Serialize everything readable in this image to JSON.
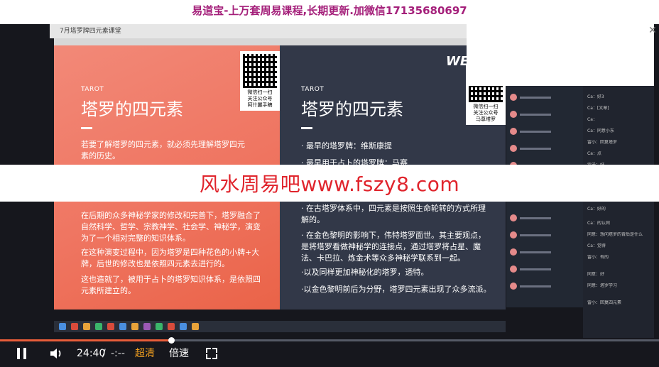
{
  "banner": {
    "text": "易道宝-上万套周易课程,长期更新.加微信17135680697"
  },
  "overlay": {
    "text": "风水周易吧www.fszy8.com"
  },
  "window": {
    "title": "7月塔罗牌四元素课堂"
  },
  "slide_left": {
    "tarot_label": "TAROT",
    "title": "塔罗的四元素",
    "intro": "若要了解塔罗的四元素，就必须先理解塔罗四元素的历史。",
    "paragraphs": [
      "在后期的众多神秘学家的修改和完善下，塔罗融合了自然科学、哲学、宗教神学、社会学、神秘学，演变为了一个相对完整的知识体系。",
      "在这种演变过程中，因为塔罗是四种花色的小牌+大牌，后世的修改也是依照四元素去进行的。",
      "这也造就了，被用于占卜的塔罗知识体系，是依照四元素所建立的。"
    ],
    "qr_caption": "微信扫一扫\n关注公众号\n阿什麗手稿"
  },
  "slide_right": {
    "tarot_label": "TAROT",
    "title": "塔罗的四元素",
    "bullets": [
      "· 最早的塔罗牌：维斯康提",
      "· 最早用于占卜的塔罗牌：马赛",
      "· 在古塔罗体系中，四元素是按照生命轮转的方式所理解的。",
      "· 在金色黎明的影响下，伟特塔罗面世。其主要观点，是将塔罗看做神秘学的连接点，通过塔罗将占星、魔法、卡巴拉、炼金术等众多神秘学联系到一起。",
      "·以及同样更加神秘化的塔罗，透特。",
      "·以金色黎明前后为分野，塔罗四元素出现了众多流派。"
    ],
    "qr_caption": "微信扫一扫\n关注公众号\n马尊塔罗",
    "logo": "WE"
  },
  "sidebar_messages": [
    "Ca：好3",
    "Ca：[文章]",
    "Ca：",
    "Ca：同意小东",
    "雷小：回复塔罗",
    "Ca：点",
    "雷子：好",
    "Ca：好的",
    "Ca：的认同",
    "同意：想问塔罗的背后是什么",
    "Ca：觉得",
    "雷小：有的",
    "同意：好",
    "同意：塔罗学习",
    "雷小：回复四元素"
  ],
  "player": {
    "current_time": "24:40",
    "separator": "/",
    "duration": "-:--",
    "quality_label": "超清",
    "speed_label": "倍速",
    "progress": 0.26
  },
  "colors": {
    "banner": "#a41f7a",
    "overlay_text": "#e0242c",
    "slide_left": "#ef7561",
    "slide_right": "#323848",
    "quality": "#f3a020",
    "progress": "#e85d3a"
  },
  "icons": [
    "pause-icon",
    "volume-icon",
    "fullscreen-icon",
    "close-icon"
  ]
}
